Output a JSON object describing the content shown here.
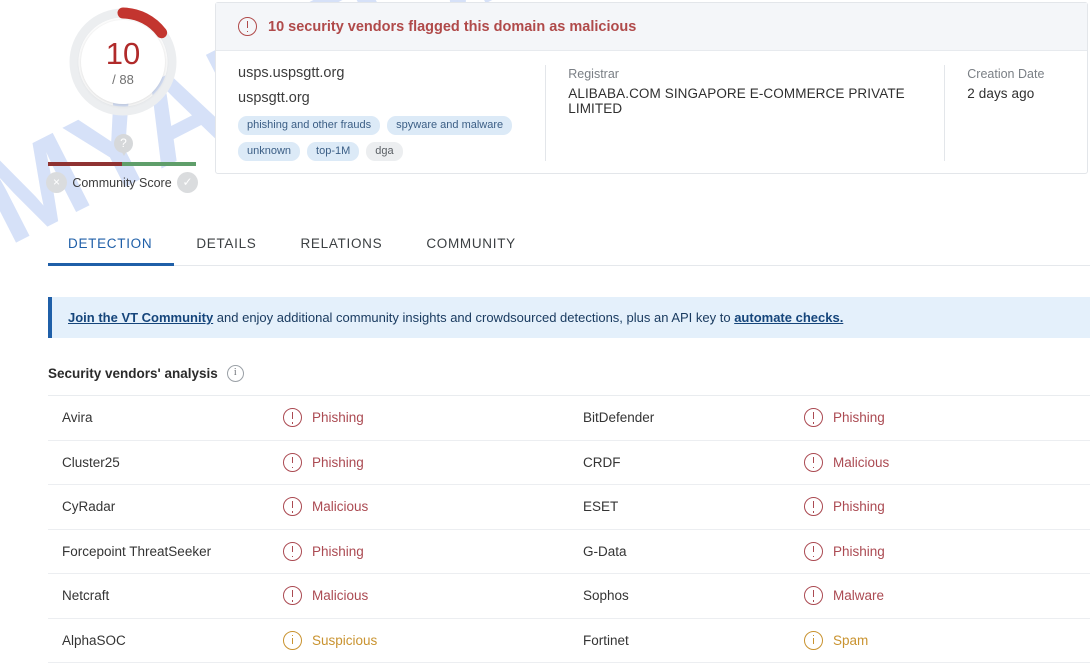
{
  "score_card": {
    "score": "10",
    "total": "/ 88",
    "score_color": "#b02a2a",
    "community_score_label": "Community Score",
    "pin_glyph": "?",
    "negative_icon": "×",
    "positive_icon": "✓",
    "bar_negative_color": "#8f3232",
    "bar_positive_color": "#5f9e6a"
  },
  "alert": {
    "text": "10 security vendors flagged this domain as malicious",
    "icon": "exclamation-circle-icon",
    "color": "#b04a4a"
  },
  "target": {
    "domain": "usps.uspsgtt.org",
    "parent_domain": "uspsgtt.org",
    "tags": [
      {
        "label": "phishing and other frauds",
        "style": "blue"
      },
      {
        "label": "spyware and malware",
        "style": "blue"
      },
      {
        "label": "unknown",
        "style": "blue"
      },
      {
        "label": "top-1M",
        "style": "blue"
      },
      {
        "label": "dga",
        "style": "gray"
      }
    ]
  },
  "meta": {
    "registrar_label": "Registrar",
    "registrar_value": "ALIBABA.COM SINGAPORE E-COMMERCE PRIVATE LIMITED",
    "creation_label": "Creation Date",
    "creation_value": "2 days ago"
  },
  "tabs": [
    {
      "label": "DETECTION",
      "active": true
    },
    {
      "label": "DETAILS",
      "active": false
    },
    {
      "label": "RELATIONS",
      "active": false
    },
    {
      "label": "COMMUNITY",
      "active": false
    }
  ],
  "banner": {
    "link1": "Join the VT Community",
    "middle": " and enjoy additional community insights and crowdsourced detections, plus an API key to ",
    "link2": "automate checks.",
    "accent_color": "#1f5fa8"
  },
  "vendors_section": {
    "title": "Security vendors' analysis",
    "info_icon": "info-icon"
  },
  "vendors": [
    {
      "name": "Avira",
      "result": "Phishing",
      "severity": "malicious"
    },
    {
      "name": "BitDefender",
      "result": "Phishing",
      "severity": "malicious"
    },
    {
      "name": "Cluster25",
      "result": "Phishing",
      "severity": "malicious"
    },
    {
      "name": "CRDF",
      "result": "Malicious",
      "severity": "malicious"
    },
    {
      "name": "CyRadar",
      "result": "Malicious",
      "severity": "malicious"
    },
    {
      "name": "ESET",
      "result": "Phishing",
      "severity": "malicious"
    },
    {
      "name": "Forcepoint ThreatSeeker",
      "result": "Phishing",
      "severity": "malicious"
    },
    {
      "name": "G-Data",
      "result": "Phishing",
      "severity": "malicious"
    },
    {
      "name": "Netcraft",
      "result": "Malicious",
      "severity": "malicious"
    },
    {
      "name": "Sophos",
      "result": "Malware",
      "severity": "malicious"
    },
    {
      "name": "AlphaSOC",
      "result": "Suspicious",
      "severity": "suspicious"
    },
    {
      "name": "Fortinet",
      "result": "Spam",
      "severity": "suspicious"
    }
  ],
  "watermark": {
    "text": "MYANTISPYWARE.COM",
    "color": "#cfdcf7"
  }
}
